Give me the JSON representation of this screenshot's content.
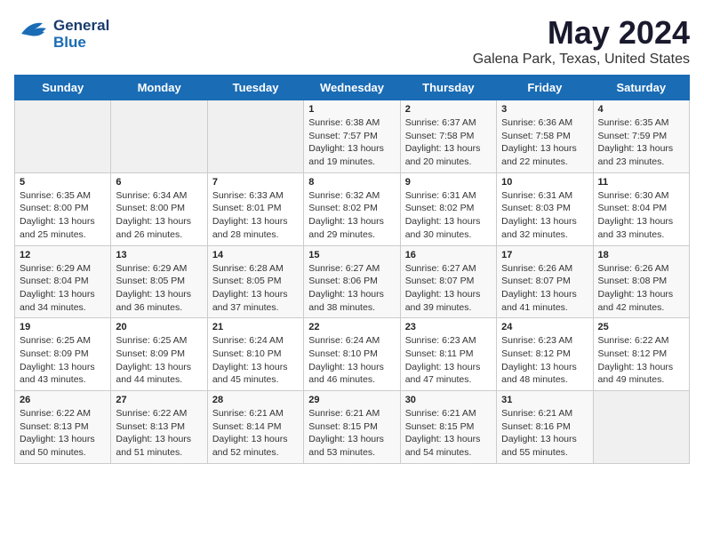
{
  "header": {
    "logo_line1": "General",
    "logo_line2": "Blue",
    "month_year": "May 2024",
    "location": "Galena Park, Texas, United States"
  },
  "days_of_week": [
    "Sunday",
    "Monday",
    "Tuesday",
    "Wednesday",
    "Thursday",
    "Friday",
    "Saturday"
  ],
  "weeks": [
    [
      {
        "day": "",
        "info": ""
      },
      {
        "day": "",
        "info": ""
      },
      {
        "day": "",
        "info": ""
      },
      {
        "day": "1",
        "info": "Sunrise: 6:38 AM\nSunset: 7:57 PM\nDaylight: 13 hours and 19 minutes."
      },
      {
        "day": "2",
        "info": "Sunrise: 6:37 AM\nSunset: 7:58 PM\nDaylight: 13 hours and 20 minutes."
      },
      {
        "day": "3",
        "info": "Sunrise: 6:36 AM\nSunset: 7:58 PM\nDaylight: 13 hours and 22 minutes."
      },
      {
        "day": "4",
        "info": "Sunrise: 6:35 AM\nSunset: 7:59 PM\nDaylight: 13 hours and 23 minutes."
      }
    ],
    [
      {
        "day": "5",
        "info": "Sunrise: 6:35 AM\nSunset: 8:00 PM\nDaylight: 13 hours and 25 minutes."
      },
      {
        "day": "6",
        "info": "Sunrise: 6:34 AM\nSunset: 8:00 PM\nDaylight: 13 hours and 26 minutes."
      },
      {
        "day": "7",
        "info": "Sunrise: 6:33 AM\nSunset: 8:01 PM\nDaylight: 13 hours and 28 minutes."
      },
      {
        "day": "8",
        "info": "Sunrise: 6:32 AM\nSunset: 8:02 PM\nDaylight: 13 hours and 29 minutes."
      },
      {
        "day": "9",
        "info": "Sunrise: 6:31 AM\nSunset: 8:02 PM\nDaylight: 13 hours and 30 minutes."
      },
      {
        "day": "10",
        "info": "Sunrise: 6:31 AM\nSunset: 8:03 PM\nDaylight: 13 hours and 32 minutes."
      },
      {
        "day": "11",
        "info": "Sunrise: 6:30 AM\nSunset: 8:04 PM\nDaylight: 13 hours and 33 minutes."
      }
    ],
    [
      {
        "day": "12",
        "info": "Sunrise: 6:29 AM\nSunset: 8:04 PM\nDaylight: 13 hours and 34 minutes."
      },
      {
        "day": "13",
        "info": "Sunrise: 6:29 AM\nSunset: 8:05 PM\nDaylight: 13 hours and 36 minutes."
      },
      {
        "day": "14",
        "info": "Sunrise: 6:28 AM\nSunset: 8:05 PM\nDaylight: 13 hours and 37 minutes."
      },
      {
        "day": "15",
        "info": "Sunrise: 6:27 AM\nSunset: 8:06 PM\nDaylight: 13 hours and 38 minutes."
      },
      {
        "day": "16",
        "info": "Sunrise: 6:27 AM\nSunset: 8:07 PM\nDaylight: 13 hours and 39 minutes."
      },
      {
        "day": "17",
        "info": "Sunrise: 6:26 AM\nSunset: 8:07 PM\nDaylight: 13 hours and 41 minutes."
      },
      {
        "day": "18",
        "info": "Sunrise: 6:26 AM\nSunset: 8:08 PM\nDaylight: 13 hours and 42 minutes."
      }
    ],
    [
      {
        "day": "19",
        "info": "Sunrise: 6:25 AM\nSunset: 8:09 PM\nDaylight: 13 hours and 43 minutes."
      },
      {
        "day": "20",
        "info": "Sunrise: 6:25 AM\nSunset: 8:09 PM\nDaylight: 13 hours and 44 minutes."
      },
      {
        "day": "21",
        "info": "Sunrise: 6:24 AM\nSunset: 8:10 PM\nDaylight: 13 hours and 45 minutes."
      },
      {
        "day": "22",
        "info": "Sunrise: 6:24 AM\nSunset: 8:10 PM\nDaylight: 13 hours and 46 minutes."
      },
      {
        "day": "23",
        "info": "Sunrise: 6:23 AM\nSunset: 8:11 PM\nDaylight: 13 hours and 47 minutes."
      },
      {
        "day": "24",
        "info": "Sunrise: 6:23 AM\nSunset: 8:12 PM\nDaylight: 13 hours and 48 minutes."
      },
      {
        "day": "25",
        "info": "Sunrise: 6:22 AM\nSunset: 8:12 PM\nDaylight: 13 hours and 49 minutes."
      }
    ],
    [
      {
        "day": "26",
        "info": "Sunrise: 6:22 AM\nSunset: 8:13 PM\nDaylight: 13 hours and 50 minutes."
      },
      {
        "day": "27",
        "info": "Sunrise: 6:22 AM\nSunset: 8:13 PM\nDaylight: 13 hours and 51 minutes."
      },
      {
        "day": "28",
        "info": "Sunrise: 6:21 AM\nSunset: 8:14 PM\nDaylight: 13 hours and 52 minutes."
      },
      {
        "day": "29",
        "info": "Sunrise: 6:21 AM\nSunset: 8:15 PM\nDaylight: 13 hours and 53 minutes."
      },
      {
        "day": "30",
        "info": "Sunrise: 6:21 AM\nSunset: 8:15 PM\nDaylight: 13 hours and 54 minutes."
      },
      {
        "day": "31",
        "info": "Sunrise: 6:21 AM\nSunset: 8:16 PM\nDaylight: 13 hours and 55 minutes."
      },
      {
        "day": "",
        "info": ""
      }
    ]
  ]
}
